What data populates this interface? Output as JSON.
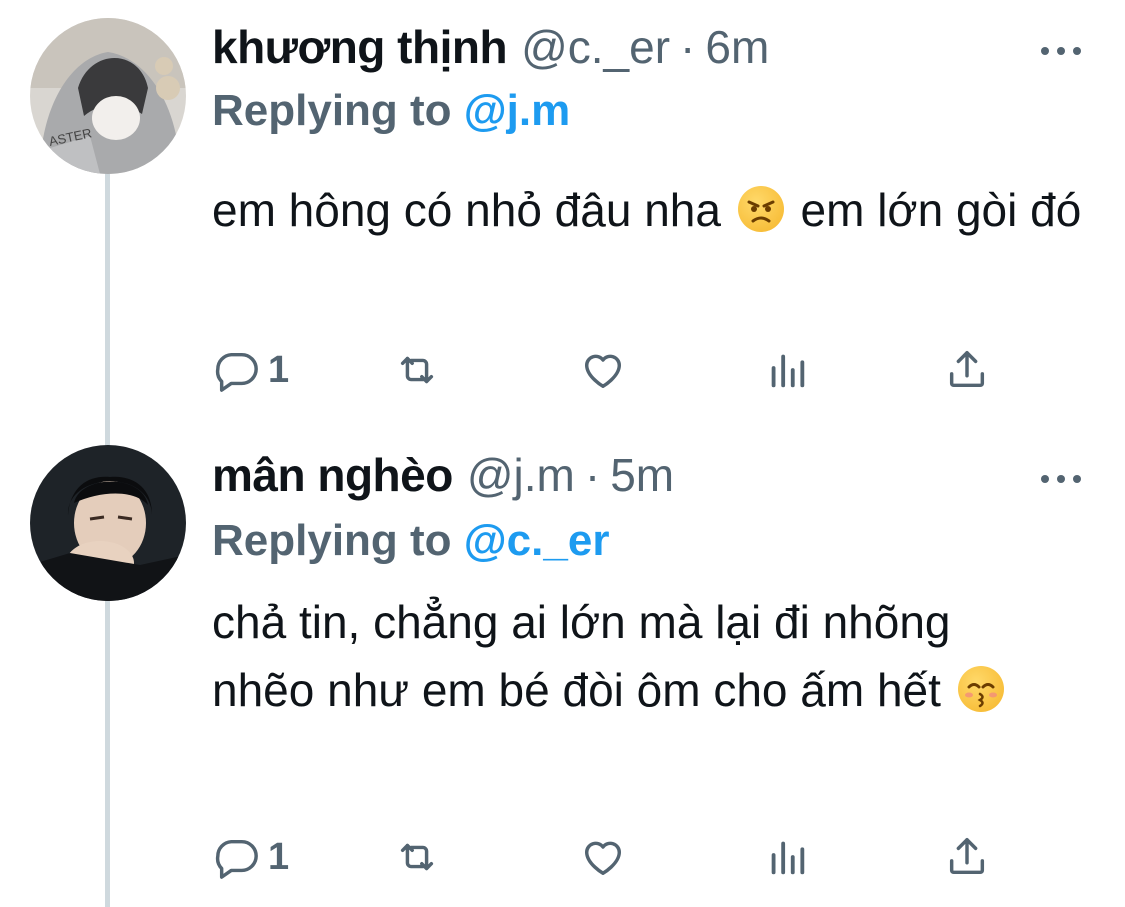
{
  "tweets": [
    {
      "name": "khương thịnh",
      "handle": "@c._er",
      "dot": "·",
      "time": "6m",
      "replying_prefix": "Replying to ",
      "replying_to": "@j.m",
      "body_part1": "em hông có nhỏ đâu nha",
      "body_part2": " em lớn gòi đó",
      "emoji": "angry-face-emoji",
      "reply_count": "1"
    },
    {
      "name": "mân nghèo",
      "handle": "@j.m",
      "dot": "·",
      "time": "5m",
      "replying_prefix": "Replying to ",
      "replying_to": "@c._er",
      "body_part1": "chả tin, chẳng ai lớn mà lại đi nhõng nhẽo như em bé đòi ôm cho ấm hết",
      "body_part2": "",
      "emoji": "kissing-face-emoji",
      "reply_count": "1"
    }
  ],
  "colors": {
    "text": "#0f1419",
    "secondary": "#536471",
    "link": "#1d9bf0",
    "thread_line": "#cfd9de"
  }
}
